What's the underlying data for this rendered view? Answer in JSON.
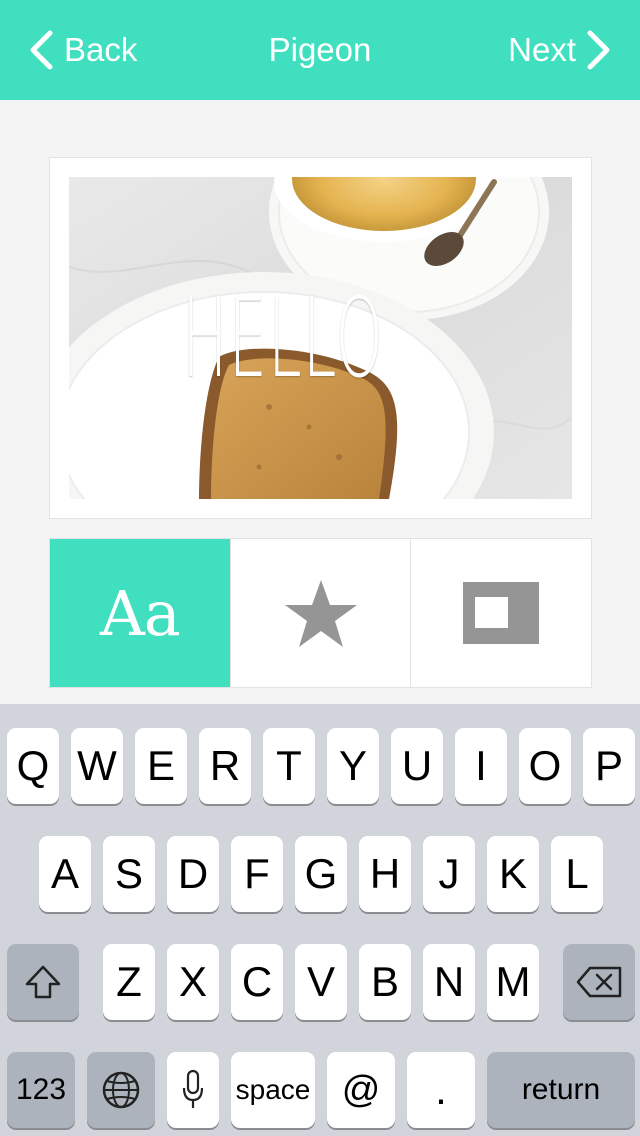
{
  "nav": {
    "back_label": "Back",
    "title": "Pigeon",
    "next_label": "Next",
    "background": "#40dfbf"
  },
  "photo": {
    "overlay_text": "HELLO"
  },
  "tools": [
    {
      "label": "Aa",
      "icon": "text-style-icon",
      "active": true
    },
    {
      "label": "",
      "icon": "star-icon",
      "active": false
    },
    {
      "label": "",
      "icon": "frame-icon",
      "active": false
    }
  ],
  "keyboard": {
    "row1": [
      "Q",
      "W",
      "E",
      "R",
      "T",
      "Y",
      "U",
      "I",
      "O",
      "P"
    ],
    "row2": [
      "A",
      "S",
      "D",
      "F",
      "G",
      "H",
      "J",
      "K",
      "L"
    ],
    "row3": [
      "Z",
      "X",
      "C",
      "V",
      "B",
      "N",
      "M"
    ],
    "shift_icon": "shift-icon",
    "delete_icon": "backspace-icon",
    "numbers_label": "123",
    "globe_icon": "globe-icon",
    "mic_icon": "microphone-icon",
    "space_label": "space",
    "at_label": "@",
    "period_label": ".",
    "return_label": "return"
  }
}
